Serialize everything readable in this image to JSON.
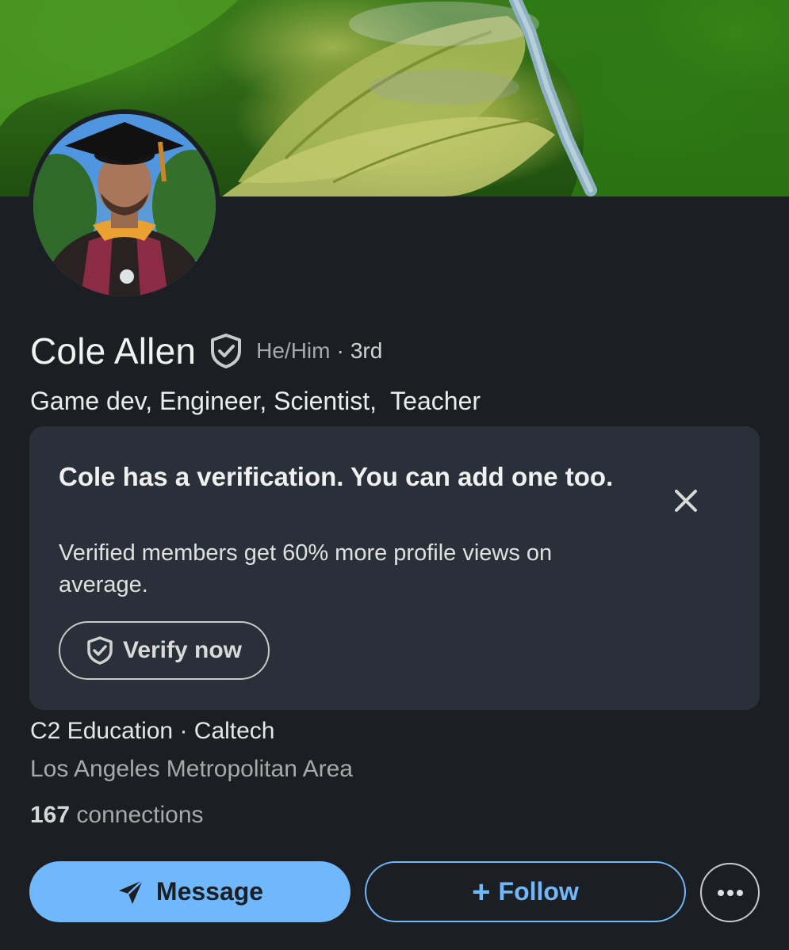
{
  "profile": {
    "name": "Cole Allen",
    "pronouns": "He/Him",
    "separator": "·",
    "degree": "3rd",
    "headline": "Game dev, Engineer, Scientist,  Teacher",
    "company_line": "C2 Education · Caltech",
    "location": "Los Angeles Metropolitan Area",
    "connections_count": "167",
    "connections_label": "connections"
  },
  "verification_card": {
    "title": "Cole has a verification. You can add one too.",
    "body": "Verified members get 60% more profile views on average.",
    "button_label": "Verify now"
  },
  "actions": {
    "message_label": "Message",
    "follow_label": "Follow",
    "follow_prefix": "+"
  },
  "icons": {
    "verified": "shield-check-icon",
    "close": "close-icon",
    "send": "paper-plane-icon",
    "more": "ellipsis-icon"
  },
  "colors": {
    "background": "#1b1f23",
    "card": "#293039",
    "accent": "#71b7fb"
  }
}
